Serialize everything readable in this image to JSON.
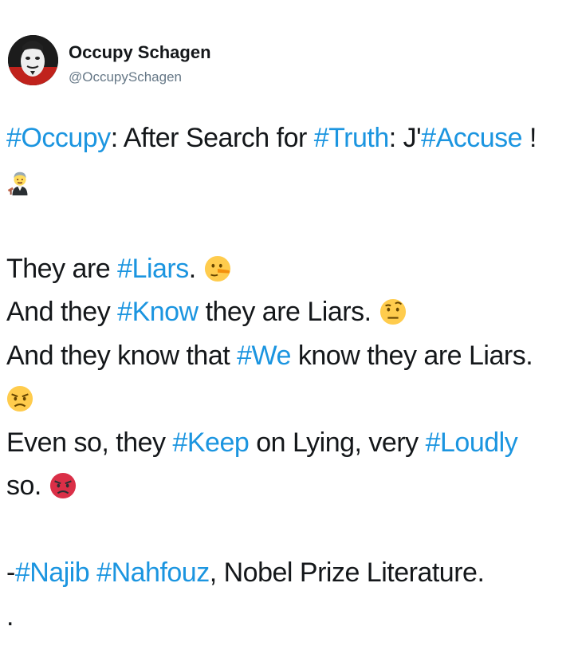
{
  "tweet": {
    "name": "Occupy Schagen",
    "handle": "@OccupySchagen",
    "lines": [
      [
        {
          "t": "#Occupy",
          "tag": true
        },
        {
          "t": ": After Search for "
        },
        {
          "t": "#Truth",
          "tag": true
        },
        {
          "t": ": J'"
        },
        {
          "t": "#Accuse",
          "tag": true
        },
        {
          "t": " !"
        }
      ],
      [
        {
          "emoji": "judge-emoji"
        }
      ],
      [],
      [
        {
          "t": "They are "
        },
        {
          "t": "#Liars",
          "tag": true
        },
        {
          "t": "."
        },
        {
          "emoji": "lying-face-emoji"
        }
      ],
      [
        {
          "t": "And they "
        },
        {
          "t": "#Know",
          "tag": true
        },
        {
          "t": " they are Liars."
        },
        {
          "emoji": "raised-eyebrow-emoji"
        }
      ],
      [
        {
          "t": "And they know that "
        },
        {
          "t": "#We",
          "tag": true
        },
        {
          "t": " know they are Liars."
        }
      ],
      [
        {
          "emoji": "angry-face-emoji"
        }
      ],
      [
        {
          "t": "Even so, they "
        },
        {
          "t": "#Keep",
          "tag": true
        },
        {
          "t": " on Lying, very "
        },
        {
          "t": "#Loudly",
          "tag": true
        }
      ],
      [
        {
          "t": "so."
        },
        {
          "emoji": "pouting-face-emoji"
        }
      ],
      [],
      [
        {
          "t": "-"
        },
        {
          "t": "#Najib",
          "tag": true
        },
        {
          "t": " "
        },
        {
          "t": "#Nahfouz",
          "tag": true
        },
        {
          "t": ", Nobel Prize Literature."
        }
      ],
      [
        {
          "t": "."
        }
      ]
    ]
  },
  "colors": {
    "link": "#1b95e0",
    "text": "#14171a",
    "muted": "#657786"
  }
}
